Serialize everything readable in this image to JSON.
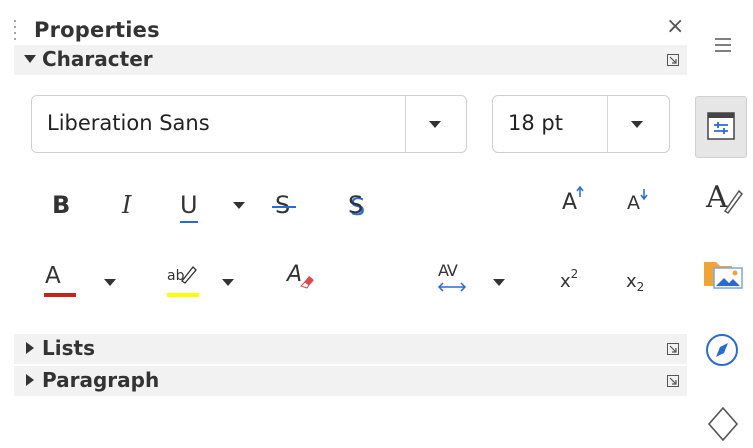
{
  "panel": {
    "title": "Properties",
    "close": "×"
  },
  "sections": {
    "character": {
      "label": "Character"
    },
    "lists": {
      "label": "Lists"
    },
    "paragraph": {
      "label": "Paragraph"
    }
  },
  "font": {
    "name": "Liberation Sans",
    "size": "18 pt"
  },
  "toolbar": {
    "bold": "B",
    "italic": "I",
    "underline": "U",
    "strikethrough": "S",
    "shadow": "S",
    "grow": "A",
    "shrink": "A",
    "font_color": "A",
    "highlight": "ab",
    "clear_formatting": "A",
    "spacing": "AV",
    "superscript_base": "x",
    "superscript_exp": "2",
    "subscript_base": "x",
    "subscript_sub": "2"
  },
  "colors": {
    "font_color": "#c9211e",
    "highlight": "#ffff00",
    "spacing_arrow": "#2a6bd2"
  }
}
